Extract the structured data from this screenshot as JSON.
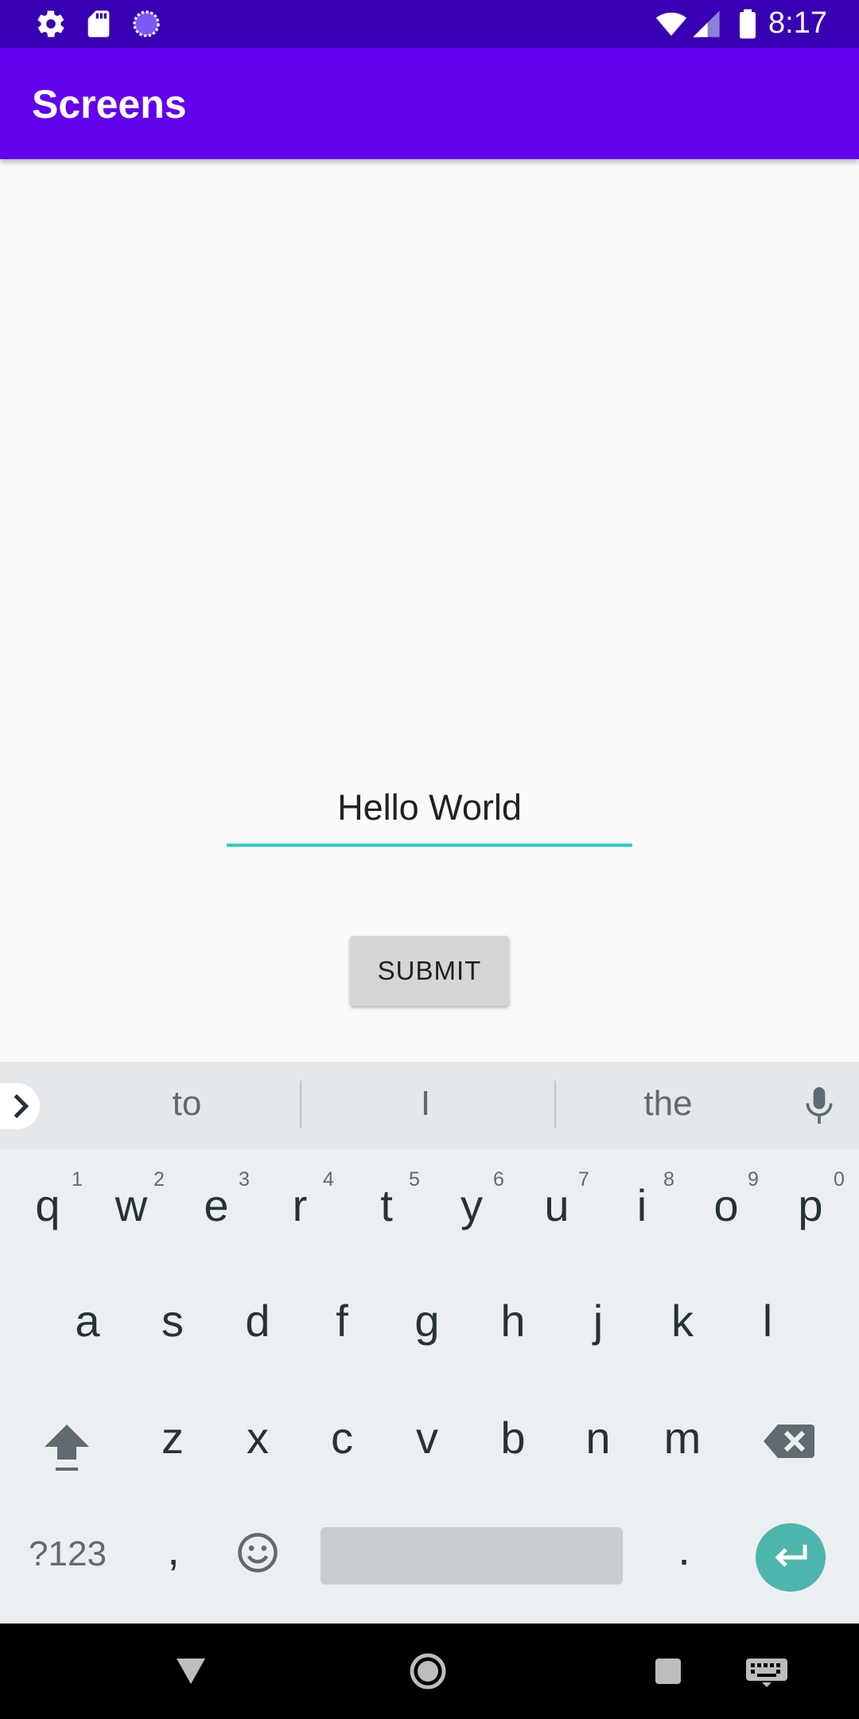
{
  "status_bar": {
    "time": "8:17",
    "left_icons": [
      "settings-icon",
      "sd-card-icon",
      "sync-icon"
    ],
    "right_icons": [
      "wifi-icon",
      "cell-signal-icon",
      "battery-icon"
    ]
  },
  "app_bar": {
    "title": "Screens"
  },
  "main": {
    "text_field_value": "Hello World",
    "submit_label": "SUBMIT"
  },
  "keyboard": {
    "suggestions": [
      "to",
      "I",
      "the"
    ],
    "row1": [
      {
        "key": "q",
        "hint": "1"
      },
      {
        "key": "w",
        "hint": "2"
      },
      {
        "key": "e",
        "hint": "3"
      },
      {
        "key": "r",
        "hint": "4"
      },
      {
        "key": "t",
        "hint": "5"
      },
      {
        "key": "y",
        "hint": "6"
      },
      {
        "key": "u",
        "hint": "7"
      },
      {
        "key": "i",
        "hint": "8"
      },
      {
        "key": "o",
        "hint": "9"
      },
      {
        "key": "p",
        "hint": "0"
      }
    ],
    "row2": [
      "a",
      "s",
      "d",
      "f",
      "g",
      "h",
      "j",
      "k",
      "l"
    ],
    "row3": [
      "z",
      "x",
      "c",
      "v",
      "b",
      "n",
      "m"
    ],
    "symbols_label": "?123",
    "comma": ",",
    "period": ".",
    "accent_color": "#4db6ac"
  },
  "nav_bar": {
    "icons": [
      "back-icon",
      "home-icon",
      "recents-icon",
      "keyboard-switch-icon"
    ]
  },
  "colors": {
    "status_bar": "#3700b3",
    "app_bar": "#6200ee",
    "field_underline": "#2bcfc0"
  }
}
